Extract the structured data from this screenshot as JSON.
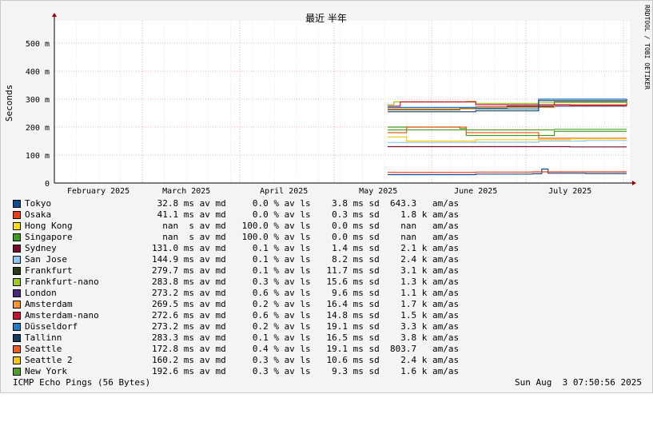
{
  "chart_data": {
    "type": "line",
    "title": "最近 半年",
    "ylabel": "Seconds",
    "watermark": "RRDTOOL / TOBI OETIKER",
    "ylim": [
      0,
      0.58
    ],
    "y_ticks": [
      {
        "v": 0,
        "label": "0"
      },
      {
        "v": 0.1,
        "label": "100 m"
      },
      {
        "v": 0.2,
        "label": "200 m"
      },
      {
        "v": 0.3,
        "label": "300 m"
      },
      {
        "v": 0.4,
        "label": "400 m"
      },
      {
        "v": 0.5,
        "label": "500 m"
      }
    ],
    "x_start": "2025-02-01",
    "x_end": "2025-08-03",
    "x_ticks": [
      {
        "date": "2025-02-15",
        "label": "February 2025"
      },
      {
        "date": "2025-03-15",
        "label": "March 2025"
      },
      {
        "date": "2025-04-15",
        "label": "April 2025"
      },
      {
        "date": "2025-05-15",
        "label": "May 2025"
      },
      {
        "date": "2025-06-15",
        "label": "June 2025"
      },
      {
        "date": "2025-07-15",
        "label": "July 2025"
      }
    ],
    "month_boundaries": [
      "2025-03-01",
      "2025-04-01",
      "2025-05-01",
      "2025-06-01",
      "2025-07-01",
      "2025-08-01"
    ],
    "grid": true,
    "legend_position": "bottom",
    "series": [
      {
        "name": "Tokyo",
        "color": "#0a4f96",
        "avg": "32.8 ms av md",
        "loss": "0.0 % av ls",
        "sd": "3.8 ms sd",
        "am": "643.3   am/as",
        "points": [
          [
            "2025-05-18",
            0.03
          ],
          [
            "2025-06-15",
            0.032
          ],
          [
            "2025-07-03",
            0.033
          ],
          [
            "2025-07-06",
            0.05
          ],
          [
            "2025-07-08",
            0.035
          ],
          [
            "2025-07-20",
            0.034
          ],
          [
            "2025-08-02",
            0.034
          ]
        ]
      },
      {
        "name": "Osaka",
        "color": "#f03c14",
        "avg": "41.1 ms av md",
        "loss": "0.0 % av ls",
        "sd": "0.3 ms sd",
        "am": "1.8 k am/as",
        "points": [
          [
            "2025-05-18",
            0.038
          ],
          [
            "2025-06-15",
            0.039
          ],
          [
            "2025-07-03",
            0.04
          ],
          [
            "2025-08-02",
            0.04
          ]
        ]
      },
      {
        "name": "Hong Kong",
        "color": "#fadc14",
        "avg": "  nan  s av md",
        "loss": "100.0 % av ls",
        "sd": "0.0 ms sd",
        "am": "nan   am/as",
        "points": []
      },
      {
        "name": "Singapore",
        "color": "#3c9c1e",
        "avg": "  nan  s av md",
        "loss": "100.0 % av ls",
        "sd": "0.0 ms sd",
        "am": "nan   am/as",
        "points": [
          [
            "2025-05-18",
            0.2
          ],
          [
            "2025-06-10",
            0.195
          ],
          [
            "2025-06-12",
            0.17
          ],
          [
            "2025-07-05",
            0.17
          ],
          [
            "2025-07-10",
            0.185
          ],
          [
            "2025-08-02",
            0.185
          ]
        ]
      },
      {
        "name": "Sydney",
        "color": "#7d0a2e",
        "avg": "131.0 ms av md",
        "loss": "0.1 % av ls",
        "sd": "1.4 ms sd",
        "am": "2.1 k am/as",
        "points": [
          [
            "2025-05-18",
            0.13
          ],
          [
            "2025-06-15",
            0.13
          ],
          [
            "2025-07-15",
            0.129
          ],
          [
            "2025-08-02",
            0.129
          ]
        ]
      },
      {
        "name": "San Jose",
        "color": "#8cc8f0",
        "avg": "144.9 ms av md",
        "loss": "0.1 % av ls",
        "sd": "8.2 ms sd",
        "am": "2.4 k am/as",
        "points": [
          [
            "2025-05-18",
            0.145
          ],
          [
            "2025-06-15",
            0.146
          ],
          [
            "2025-07-05",
            0.15
          ],
          [
            "2025-07-20",
            0.152
          ],
          [
            "2025-08-02",
            0.15
          ]
        ]
      },
      {
        "name": "Frankfurt",
        "color": "#2d3c14",
        "avg": "279.7 ms av md",
        "loss": "0.1 % av ls",
        "sd": "11.7 ms sd",
        "am": "3.1 k am/as",
        "points": [
          [
            "2025-05-18",
            0.262
          ],
          [
            "2025-06-10",
            0.268
          ],
          [
            "2025-06-25",
            0.275
          ],
          [
            "2025-07-10",
            0.29
          ],
          [
            "2025-08-02",
            0.28
          ]
        ]
      },
      {
        "name": "Frankfurt-nano",
        "color": "#a0c81e",
        "avg": "283.8 ms av md",
        "loss": "0.3 % av ls",
        "sd": "15.6 ms sd",
        "am": "1.3 k am/as",
        "points": [
          [
            "2025-05-18",
            0.28
          ],
          [
            "2025-05-20",
            0.29
          ],
          [
            "2025-06-12",
            0.292
          ],
          [
            "2025-06-15",
            0.285
          ],
          [
            "2025-07-05",
            0.288
          ],
          [
            "2025-08-02",
            0.285
          ]
        ]
      },
      {
        "name": "London",
        "color": "#4b287d",
        "avg": "273.2 ms av md",
        "loss": "0.6 % av ls",
        "sd": "9.6 ms sd",
        "am": "1.1 k am/as",
        "points": [
          [
            "2025-05-18",
            0.27
          ],
          [
            "2025-06-15",
            0.272
          ],
          [
            "2025-07-10",
            0.275
          ],
          [
            "2025-08-02",
            0.275
          ]
        ]
      },
      {
        "name": "Amsterdam",
        "color": "#fa9628",
        "avg": "269.5 ms av md",
        "loss": "0.2 % av ls",
        "sd": "16.4 ms sd",
        "am": "1.7 k am/as",
        "points": [
          [
            "2025-05-18",
            0.265
          ],
          [
            "2025-06-15",
            0.27
          ],
          [
            "2025-07-10",
            0.28
          ],
          [
            "2025-08-02",
            0.275
          ]
        ]
      },
      {
        "name": "Amsterdam-nano",
        "color": "#c81432",
        "avg": "272.6 ms av md",
        "loss": "0.6 % av ls",
        "sd": "14.8 ms sd",
        "am": "1.5 k am/as",
        "points": [
          [
            "2025-05-18",
            0.275
          ],
          [
            "2025-05-22",
            0.29
          ],
          [
            "2025-06-15",
            0.28
          ],
          [
            "2025-07-15",
            0.278
          ],
          [
            "2025-08-02",
            0.28
          ]
        ]
      },
      {
        "name": "Düsseldorf",
        "color": "#1e7dc8",
        "avg": "273.2 ms av md",
        "loss": "0.2 % av ls",
        "sd": "19.1 ms sd",
        "am": "3.3 k am/as",
        "points": [
          [
            "2025-05-18",
            0.27
          ],
          [
            "2025-06-15",
            0.265
          ],
          [
            "2025-07-05",
            0.3
          ],
          [
            "2025-08-02",
            0.3
          ]
        ]
      },
      {
        "name": "Tallinn",
        "color": "#143c64",
        "avg": "283.3 ms av md",
        "loss": "0.1 % av ls",
        "sd": "16.5 ms sd",
        "am": "3.8 k am/as",
        "points": [
          [
            "2025-05-18",
            0.255
          ],
          [
            "2025-06-15",
            0.258
          ],
          [
            "2025-07-05",
            0.295
          ],
          [
            "2025-08-02",
            0.3
          ]
        ]
      },
      {
        "name": "Seattle",
        "color": "#f55a1e",
        "avg": "172.8 ms av md",
        "loss": "0.4 % av ls",
        "sd": "19.1 ms sd",
        "am": "803.7   am/as",
        "points": [
          [
            "2025-05-18",
            0.18
          ],
          [
            "2025-05-24",
            0.2
          ],
          [
            "2025-06-12",
            0.18
          ],
          [
            "2025-07-05",
            0.16
          ],
          [
            "2025-08-02",
            0.16
          ]
        ]
      },
      {
        "name": "Seattle 2",
        "color": "#f5c80a",
        "avg": "160.2 ms av md",
        "loss": "0.3 % av ls",
        "sd": "10.6 ms sd",
        "am": "2.4 k am/as",
        "points": [
          [
            "2025-05-18",
            0.165
          ],
          [
            "2025-05-24",
            0.15
          ],
          [
            "2025-06-15",
            0.155
          ],
          [
            "2025-07-15",
            0.158
          ],
          [
            "2025-08-02",
            0.158
          ]
        ]
      },
      {
        "name": "New York",
        "color": "#50a028",
        "avg": "192.6 ms av md",
        "loss": "0.3 % av ls",
        "sd": "9.3 ms sd",
        "am": "1.6 k am/as",
        "points": [
          [
            "2025-05-18",
            0.19
          ],
          [
            "2025-06-15",
            0.19
          ],
          [
            "2025-07-10",
            0.192
          ],
          [
            "2025-08-02",
            0.192
          ]
        ]
      }
    ]
  },
  "footer": {
    "left": "ICMP Echo Pings (56 Bytes)",
    "right": "Sun Aug  3 07:50:56 2025"
  }
}
